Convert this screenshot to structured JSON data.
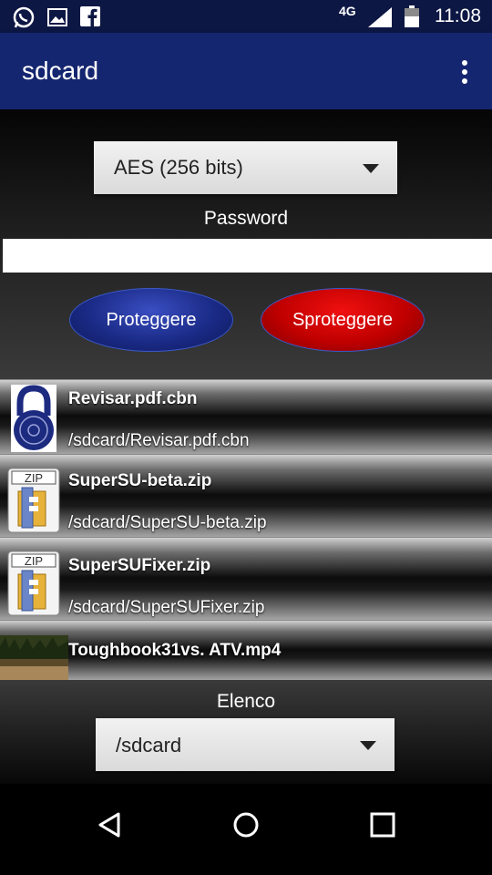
{
  "status_bar": {
    "network": "4G",
    "time": "11:08",
    "icons": [
      "whatsapp-icon",
      "gallery-icon",
      "facebook-icon",
      "signal-icon",
      "battery-icon"
    ]
  },
  "app_bar": {
    "title": "sdcard",
    "menu_icon": "overflow-menu-icon"
  },
  "form": {
    "algorithm_selected": "AES (256 bits)",
    "password_label": "Password",
    "password_value": "",
    "protect_label": "Proteggere",
    "unprotect_label": "Sproteggere"
  },
  "files": [
    {
      "name": "Revisar.pdf.cbn",
      "path": "/sdcard/Revisar.pdf.cbn",
      "icon": "padlock-icon"
    },
    {
      "name": "SuperSU-beta.zip",
      "path": "/sdcard/SuperSU-beta.zip",
      "icon": "zip-icon"
    },
    {
      "name": "SuperSUFixer.zip",
      "path": "/sdcard/SuperSUFixer.zip",
      "icon": "zip-icon"
    },
    {
      "name": "Toughbook31vs. ATV.mp4",
      "path": "",
      "icon": "video-thumbnail"
    }
  ],
  "list": {
    "label": "Elenco",
    "folder_selected": "/sdcard"
  },
  "nav": {
    "icons": [
      "back-icon",
      "home-icon",
      "recents-icon"
    ]
  },
  "colors": {
    "app_bar": "#152670",
    "status_bar": "#0d1744",
    "protect_button": "#1a2a86",
    "unprotect_button": "#c00000"
  }
}
